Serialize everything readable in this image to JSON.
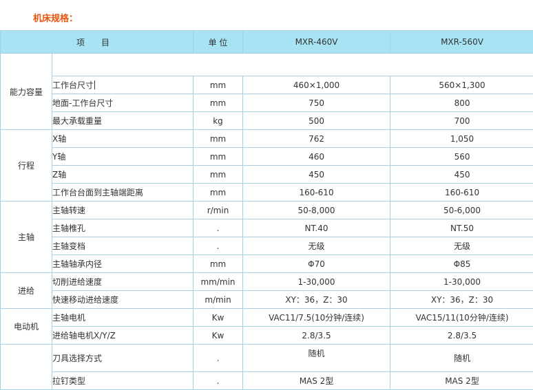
{
  "section_title": "机床规格：",
  "table": {
    "headers": {
      "item": "项　　目",
      "unit": "单 位",
      "model1": "MXR-460V",
      "model2": "MXR-560V"
    },
    "groups": [
      {
        "category": "能力容量",
        "rows": [
          {
            "param": "工作台尺寸",
            "unit": "mm",
            "v1": "460×1,000",
            "v2": "560×1,300"
          },
          {
            "param": "地面-工作台尺寸",
            "unit": "mm",
            "v1": "750",
            "v2": "800"
          },
          {
            "param": "最大承载重量",
            "unit": "kg",
            "v1": "500",
            "v2": "700"
          }
        ]
      },
      {
        "category": "行程",
        "rows": [
          {
            "param": "X轴",
            "unit": "mm",
            "v1": "762",
            "v2": "1,050"
          },
          {
            "param": "Y轴",
            "unit": "mm",
            "v1": "460",
            "v2": "560"
          },
          {
            "param": "Z轴",
            "unit": "mm",
            "v1": "450",
            "v2": "450"
          },
          {
            "param": "工作台台面到主轴端距离",
            "unit": "mm",
            "v1": "160-610",
            "v2": "160-610"
          }
        ]
      },
      {
        "category": "主轴",
        "rows": [
          {
            "param": "主轴转速",
            "unit": "r/min",
            "v1": "50-8,000",
            "v2": "50-6,000"
          },
          {
            "param": "主轴椎孔",
            "unit": ".",
            "v1": "NT.40",
            "v2": "NT.50"
          },
          {
            "param": "主轴变档",
            "unit": ".",
            "v1": "无级",
            "v2": "无级"
          },
          {
            "param": "主轴轴承内径",
            "unit": "mm",
            "v1": "Φ70",
            "v2": "Φ85"
          }
        ]
      },
      {
        "category": "进给",
        "rows": [
          {
            "param": "切削进给速度",
            "unit": "mm/min",
            "v1": "1-30,000",
            "v2": "1-30,000"
          },
          {
            "param": "快速移动进给速度",
            "unit": "m/min",
            "v1": "XY：36，Z：30",
            "v2": "XY：36，Z：30"
          }
        ]
      },
      {
        "category": "电动机",
        "rows": [
          {
            "param": "主轴电机",
            "unit": "Kw",
            "v1": "VAC11/7.5(10分钟/连续)",
            "v2": "VAC15/11(10分钟/连续)"
          },
          {
            "param": "进给轴电机X/Y/Z",
            "unit": "Kw",
            "v1": "2.8/3.5",
            "v2": "2.8/3.5"
          }
        ]
      },
      {
        "category": "",
        "rows": [
          {
            "param": "刀具选择方式",
            "unit": ".",
            "v1": "随机",
            "v2": "随机"
          },
          {
            "param": "拉钉类型",
            "unit": ".",
            "v1": "MAS 2型",
            "v2": "MAS 2型"
          }
        ]
      }
    ]
  }
}
